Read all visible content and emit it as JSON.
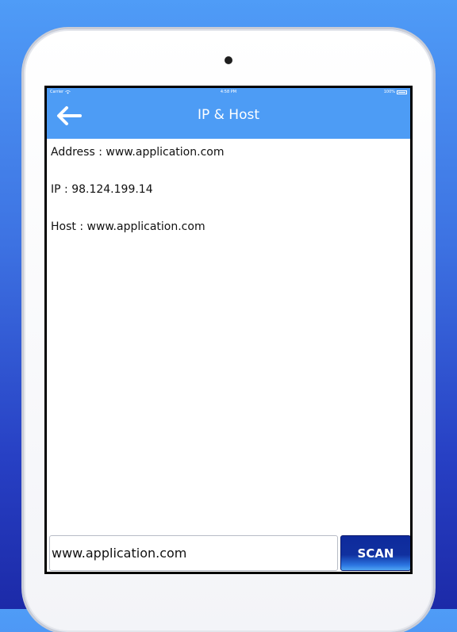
{
  "status_bar": {
    "carrier": "Carrier",
    "time": "4:58 PM",
    "battery": "100%"
  },
  "navbar": {
    "title": "IP & Host",
    "back_icon": "arrow-left-icon"
  },
  "results": {
    "address": "Address : www.application.com",
    "ip": "IP : 98.124.199.14",
    "host": "Host : www.application.com"
  },
  "scan_form": {
    "input_value": "www.application.com",
    "button_label": "SCAN"
  },
  "colors": {
    "navbar": "#4d9cf5",
    "scan_button": "#10309f",
    "background_top": "#4f9cf7",
    "background_bottom": "#1c2aa8"
  }
}
